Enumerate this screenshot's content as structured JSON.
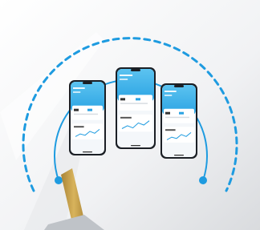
{
  "colors": {
    "background": "#ffffff",
    "accent": "#1e9be0",
    "accent_light": "#8dd0f0",
    "phone_frame": "#1b1f25",
    "screen_header": "#5cc3f0",
    "card_bg": "#ffffff",
    "pole": "#c9a24a"
  },
  "icons": [
    "dashed-arc-icon",
    "solid-arc-icon",
    "endpoint-dot-icon"
  ],
  "phones": [
    {
      "id": "left",
      "chart_points": [
        6,
        10,
        8,
        14,
        11,
        17
      ]
    },
    {
      "id": "center",
      "chart_points": [
        8,
        12,
        9,
        16,
        13,
        19
      ]
    },
    {
      "id": "right",
      "chart_points": [
        7,
        11,
        9,
        15,
        12,
        18
      ]
    }
  ]
}
